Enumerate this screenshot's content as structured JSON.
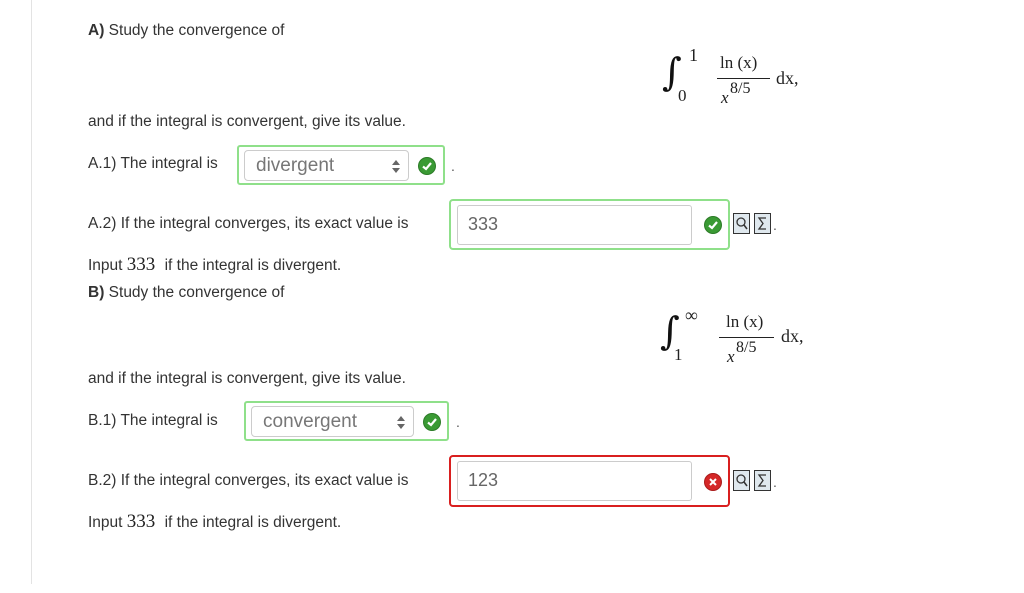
{
  "partA": {
    "heading_label": "A)",
    "heading_text": "Study the convergence of",
    "integral": {
      "lower": "0",
      "upper": "1",
      "numerator": "ln (x)",
      "denominator_base": "x",
      "denominator_exp": "8/5",
      "differential": "dx,"
    },
    "after_text": "and if the integral is convergent, give its value.",
    "q1": {
      "label": "A.1) The integral is",
      "selected": "divergent",
      "status": "correct"
    },
    "q2": {
      "label": "A.2) If the integral converges, its exact value is",
      "value": "333",
      "status": "correct"
    },
    "note": {
      "prefix": "Input",
      "number": "333",
      "suffix": "if the integral is divergent."
    }
  },
  "partB": {
    "heading_label": "B)",
    "heading_text": "Study the convergence of",
    "integral": {
      "lower": "1",
      "upper": "∞",
      "numerator": "ln (x)",
      "denominator_base": "x",
      "denominator_exp": "8/5",
      "differential": "dx,"
    },
    "after_text": "and if the integral is convergent, give its value.",
    "q1": {
      "label": "B.1) The integral is",
      "selected": "convergent",
      "status": "correct"
    },
    "q2": {
      "label": "B.2) If the integral converges, its exact value is",
      "value": "123",
      "status": "incorrect"
    },
    "note": {
      "prefix": "Input",
      "number": "333",
      "suffix": "if the integral is divergent."
    }
  },
  "punctuation": {
    "period": "."
  },
  "colors": {
    "correct": "#3a9a34",
    "incorrect": "#d42727",
    "correct_border": "#8fe08a",
    "incorrect_border": "#d91f1f"
  },
  "icons": [
    "check-icon",
    "cross-icon",
    "preview-icon",
    "equation-editor-icon"
  ]
}
